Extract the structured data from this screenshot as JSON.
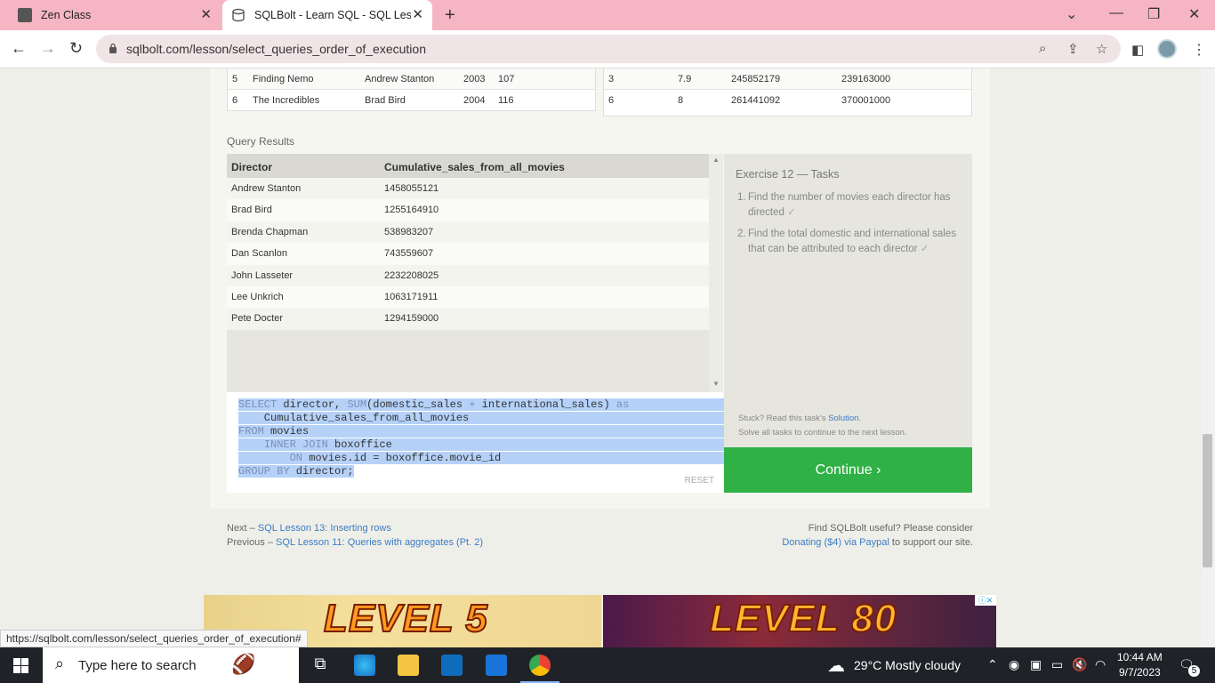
{
  "browser": {
    "tabs": [
      {
        "title": "Zen Class",
        "active": false
      },
      {
        "title": "SQLBolt - Learn SQL - SQL Lesson",
        "active": true
      }
    ],
    "url": "sqlbolt.com/lesson/select_queries_order_of_execution",
    "status_link": "https://sqlbolt.com/lesson/select_queries_order_of_execution#"
  },
  "top_tables": {
    "left_rows": [
      {
        "id": "5",
        "title": "Finding Nemo",
        "director": "Andrew Stanton",
        "year": "2003",
        "length": "107"
      },
      {
        "id": "6",
        "title": "The Incredibles",
        "director": "Brad Bird",
        "year": "2004",
        "length": "116"
      }
    ],
    "right_rows": [
      {
        "movie_id": "3",
        "rating": "7.9",
        "domestic": "245852179",
        "international": "239163000"
      },
      {
        "movie_id": "6",
        "rating": "8",
        "domestic": "261441092",
        "international": "370001000"
      }
    ]
  },
  "query_results": {
    "label": "Query Results",
    "columns": [
      "Director",
      "Cumulative_sales_from_all_movies"
    ],
    "rows": [
      [
        "Andrew Stanton",
        "1458055121"
      ],
      [
        "Brad Bird",
        "1255164910"
      ],
      [
        "Brenda Chapman",
        "538983207"
      ],
      [
        "Dan Scanlon",
        "743559607"
      ],
      [
        "John Lasseter",
        "2232208025"
      ],
      [
        "Lee Unkrich",
        "1063171911"
      ],
      [
        "Pete Docter",
        "1294159000"
      ]
    ]
  },
  "editor": {
    "lines": [
      "SELECT director, SUM(domestic_sales + international_sales) as",
      "    Cumulative_sales_from_all_movies",
      "FROM movies",
      "    INNER JOIN boxoffice",
      "        ON movies.id = boxoffice.movie_id",
      "GROUP BY director;"
    ],
    "reset_label": "RESET"
  },
  "exercise": {
    "title": "Exercise 12 — Tasks",
    "tasks": [
      {
        "num": "1.",
        "text": "Find the number of movies each director has directed",
        "check": "✓"
      },
      {
        "num": "2.",
        "text": "Find the total domestic and international sales that can be attributed to each director",
        "check": "✓"
      }
    ],
    "stuck_prefix": "Stuck? Read this task's ",
    "solution_link": "Solution",
    "stuck_suffix": ".",
    "solve_note": "Solve all tasks to continue to the next lesson.",
    "continue_label": "Continue ›"
  },
  "footer": {
    "next_prefix": "Next – ",
    "next_link": "SQL Lesson 13: Inserting rows",
    "prev_prefix": "Previous – ",
    "prev_link": "SQL Lesson 11: Queries with aggregates (Pt. 2)",
    "useful_text": "Find SQLBolt useful? Please consider",
    "donate_link": "Donating ($4) via Paypal",
    "donate_suffix": " to support our site."
  },
  "ads": {
    "ad1_text": "LEVEL 5",
    "ad2_text": "LEVEL 80"
  },
  "taskbar": {
    "search_placeholder": "Type here to search",
    "weather": "29°C  Mostly cloudy",
    "time": "10:44 AM",
    "date": "9/7/2023",
    "notification_count": "5"
  }
}
